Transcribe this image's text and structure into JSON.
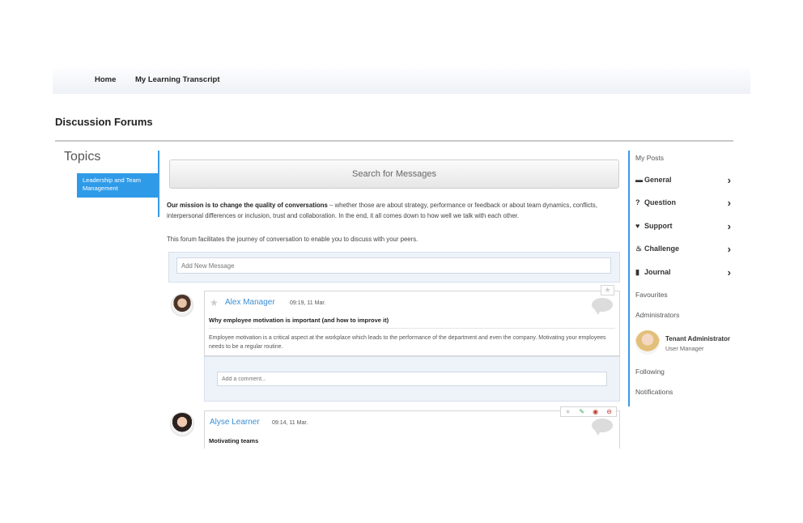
{
  "nav": {
    "home": "Home",
    "transcript": "My Learning Transcript"
  },
  "page_title": "Discussion Forums",
  "topics": {
    "title": "Topics",
    "items": [
      "Leadership and Team Management"
    ]
  },
  "search": {
    "label": "Search for Messages"
  },
  "mission": {
    "bold": "Our mission is to change the quality of conversations",
    "rest": " – whether those are about strategy, performance or feedback or about team dynamics, conflicts, interpersonal differences or inclusion, trust and collaboration. In the end, it all comes down to how well we talk with each other.",
    "facilitate": "This forum facilitates the journey of conversation to enable you to discuss with your peers."
  },
  "add_message": {
    "placeholder": "Add New Message"
  },
  "posts": [
    {
      "author": "Alex Manager",
      "time": "09:19, 11 Mar.",
      "title": "Why employee motivation is important (and how to improve it)",
      "body": "Employee motivation is a critical aspect at the workplace which leads to the performance of the department and even the company. Motivating your employees needs to be a regular routine.",
      "comment_placeholder": "Add a comment..."
    },
    {
      "author": "Alyse Learner",
      "time": "09:14, 11 Mar.",
      "title": "Motivating teams"
    }
  ],
  "sidebar": {
    "my_posts": "My Posts",
    "categories": [
      {
        "label": "General",
        "icon": "comment-icon"
      },
      {
        "label": "Question",
        "icon": "question-icon"
      },
      {
        "label": "Support",
        "icon": "heart-icon"
      },
      {
        "label": "Challenge",
        "icon": "fire-icon"
      },
      {
        "label": "Journal",
        "icon": "book-icon"
      }
    ],
    "favourites": "Favourites",
    "administrators": "Administrators",
    "admin": {
      "name": "Tenant Administrator",
      "role": "User Manager"
    },
    "following": "Following",
    "notifications": "Notifications"
  },
  "colors": {
    "accent": "#2f9be8",
    "link": "#3b8fd4",
    "panel": "#eef3fa"
  }
}
